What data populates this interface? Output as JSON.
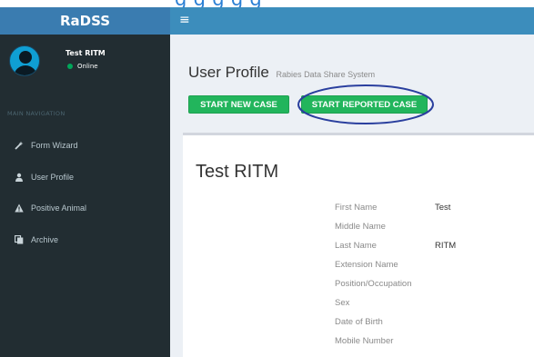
{
  "top_banner": {
    "text": "g g g g g"
  },
  "app": {
    "logo": "RaDSS",
    "menu_icon": "hamburger-icon"
  },
  "user": {
    "name": "Test RITM",
    "status": "Online"
  },
  "sidebar": {
    "header": "MAIN NAVIGATION",
    "items": [
      {
        "label": "Form Wizard",
        "icon": "magic-wand-icon"
      },
      {
        "label": "User Profile",
        "icon": "user-icon"
      },
      {
        "label": "Positive Animal",
        "icon": "warning-icon"
      },
      {
        "label": "Archive",
        "icon": "copy-icon"
      }
    ]
  },
  "page": {
    "title": "User Profile",
    "subtitle": "Rabies Data Share System"
  },
  "buttons": {
    "new_case": "START NEW CASE",
    "reported_case": "START REPORTED CASE"
  },
  "profile": {
    "name": "Test RITM",
    "fields": [
      {
        "label": "First Name",
        "value": "Test"
      },
      {
        "label": "Middle Name",
        "value": ""
      },
      {
        "label": "Last Name",
        "value": "RITM"
      },
      {
        "label": "Extension Name",
        "value": ""
      },
      {
        "label": "Position/Occupation",
        "value": ""
      },
      {
        "label": "Sex",
        "value": ""
      },
      {
        "label": "Date of Birth",
        "value": ""
      },
      {
        "label": "Mobile Number",
        "value": ""
      }
    ]
  },
  "colors": {
    "header": "#3c8dbc",
    "logo_bg": "#3a7cb0",
    "sidebar": "#222d32",
    "button": "#22b55c",
    "annotation": "#2a3f9e",
    "online": "#00a65a"
  }
}
